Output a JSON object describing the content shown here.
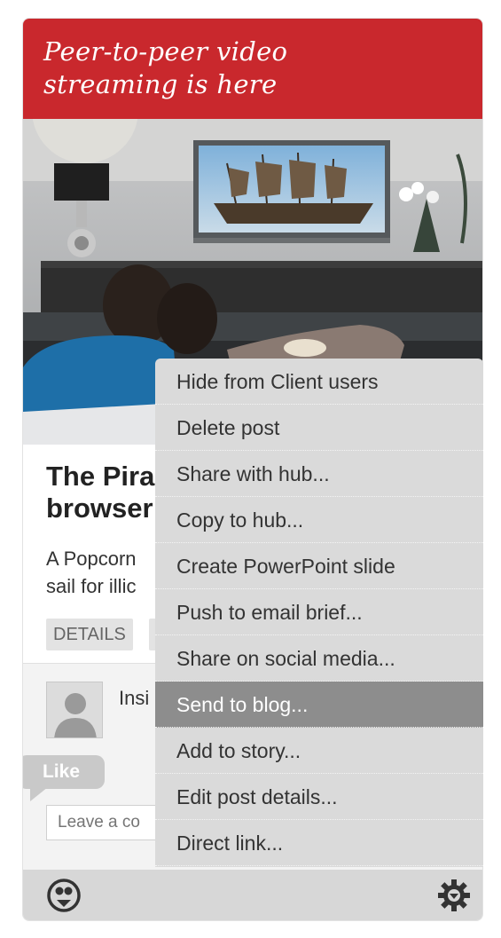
{
  "banner": {
    "title": "Peer-to-peer video streaming is here"
  },
  "post": {
    "title": "The Pira\nbrowser",
    "description": "A Popcorn\nsail for illic",
    "tags": [
      "DETAILS",
      ""
    ]
  },
  "comments": {
    "author": "Insi",
    "like_label": "Like",
    "input_placeholder": "Leave a co"
  },
  "menu": {
    "items": [
      {
        "label": "Hide from Client users"
      },
      {
        "label": "Delete post"
      },
      {
        "label": "Share with hub..."
      },
      {
        "label": "Copy to hub..."
      },
      {
        "label": "Create PowerPoint slide"
      },
      {
        "label": "Push to email brief..."
      },
      {
        "label": "Share on social media..."
      },
      {
        "label": "Send to blog..."
      },
      {
        "label": "Add to story..."
      },
      {
        "label": "Edit post details..."
      },
      {
        "label": "Direct link..."
      }
    ],
    "active_item": "Send to blog..."
  },
  "footer": {
    "left_icon": "share-hub-icon",
    "right_icon": "gear-icon"
  },
  "colors": {
    "brand_red": "#c9282d",
    "menu_bg": "#dadada",
    "menu_active": "#8d8d8d"
  }
}
